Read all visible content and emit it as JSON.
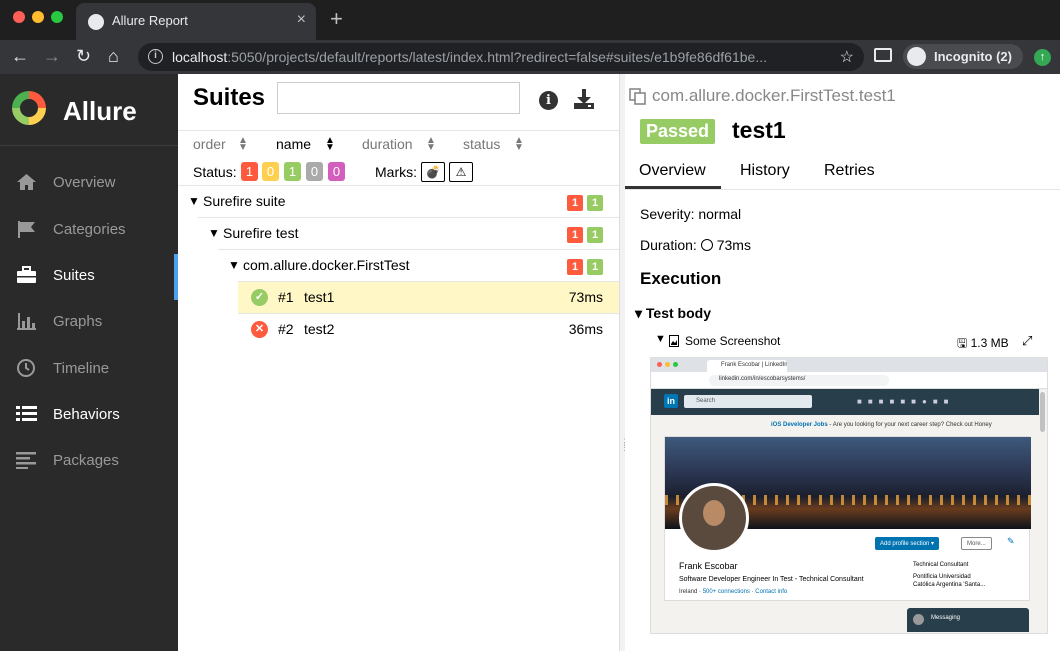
{
  "browser": {
    "tab_title": "Allure Report",
    "tab_close": "×",
    "new_tab": "+",
    "url_host": "localhost",
    "url_rest": ":5050/projects/default/reports/latest/index.html?redirect=false#suites/e1b9fe86df61be...",
    "incognito_label": "Incognito (2)",
    "traffic_colors": [
      "#fe5f57",
      "#febc2e",
      "#28c840"
    ]
  },
  "sidebar": {
    "brand": "Allure",
    "items": [
      {
        "label": "Overview",
        "icon": "home-icon"
      },
      {
        "label": "Categories",
        "icon": "flag-icon"
      },
      {
        "label": "Suites",
        "icon": "briefcase-icon"
      },
      {
        "label": "Graphs",
        "icon": "bar-chart-icon"
      },
      {
        "label": "Timeline",
        "icon": "clock-icon"
      },
      {
        "label": "Behaviors",
        "icon": "list-icon"
      },
      {
        "label": "Packages",
        "icon": "align-left-icon"
      }
    ],
    "active_item": "Suites",
    "active_color": "#4d9ff0"
  },
  "suites": {
    "title": "Suites",
    "search_value": "",
    "sort": [
      "order",
      "name",
      "duration",
      "status"
    ],
    "active_sort": "name",
    "status_label": "Status:",
    "status_counts": [
      {
        "value": "1",
        "color": "#fd5a3e"
      },
      {
        "value": "0",
        "color": "#ffd050"
      },
      {
        "value": "1",
        "color": "#97cc64"
      },
      {
        "value": "0",
        "color": "#aaaaaa"
      },
      {
        "value": "0",
        "color": "#d35ebe"
      }
    ],
    "marks_label": "Marks:",
    "tree": [
      {
        "label": "Surefire suite",
        "failed": "1",
        "passed": "1"
      },
      {
        "label": "Surefire test",
        "failed": "1",
        "passed": "1"
      },
      {
        "label": "com.allure.docker.FirstTest",
        "failed": "1",
        "passed": "1"
      }
    ],
    "tests": [
      {
        "num": "#1",
        "name": "test1",
        "duration": "73ms",
        "status": "passed",
        "selected": true
      },
      {
        "num": "#2",
        "name": "test2",
        "duration": "36ms",
        "status": "failed",
        "selected": false
      }
    ]
  },
  "details": {
    "breadcrumb": "com.allure.docker.FirstTest.test1",
    "status": "Passed",
    "title": "test1",
    "tabs": [
      "Overview",
      "History",
      "Retries"
    ],
    "active_tab": "Overview",
    "severity": "Severity: normal",
    "duration_label": "Duration:",
    "duration_value": "73ms",
    "execution_title": "Execution",
    "test_body_title": "Test body",
    "attachment": {
      "label": "Some Screenshot",
      "size": "1.3 MB"
    }
  },
  "screenshot": {
    "tab": "Frank Escobar | LinkedIn",
    "url": "linkedin.com/in/escobarsystems/",
    "search": "Search",
    "jobs_link": "iOS Developer Jobs",
    "jobs_text": " - Are you looking for your next career step? Check out Honey",
    "add_section": "Add profile section ▾",
    "more": "More...",
    "name": "Frank Escobar",
    "headline": "Software Developer Engineer In Test - Technical Consultant",
    "location": "Ireland",
    "connections": "500+ connections",
    "contact": "Contact info",
    "company": "Technical Consultant",
    "school_1": "Pontificia Universidad",
    "school_2": "Católica Argentina 'Santa...",
    "messaging": "Messaging"
  }
}
